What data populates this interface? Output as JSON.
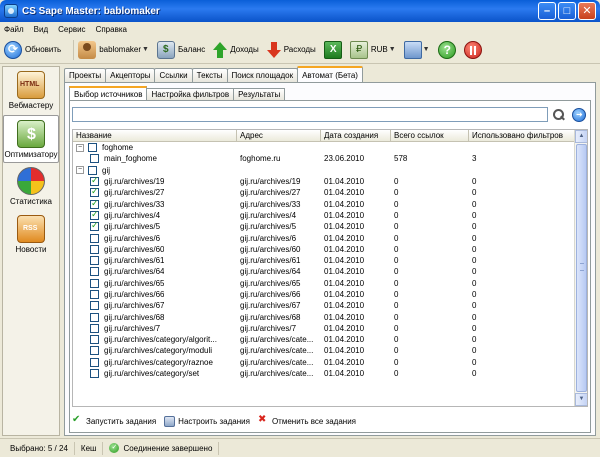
{
  "window": {
    "title": "CS Sape Master: bablomaker"
  },
  "menu": [
    "Файл",
    "Вид",
    "Сервис",
    "Справка"
  ],
  "toolbar": {
    "refresh": "Обновить",
    "user": "bablomaker",
    "balance": "Баланс",
    "income": "Доходы",
    "expenses": "Расходы",
    "currency": "RUB"
  },
  "sidebar": [
    {
      "label": "Вебмастеру",
      "icon": "webmaster-icon"
    },
    {
      "label": "Оптимизатору",
      "icon": "optimizer-icon"
    },
    {
      "label": "Статистика",
      "icon": "statistics-icon"
    },
    {
      "label": "Новости",
      "icon": "news-icon"
    }
  ],
  "tabs": [
    "Проекты",
    "Акцепторы",
    "Ссылки",
    "Тексты",
    "Поиск площадок",
    "Автомат (Бета)"
  ],
  "active_tab": 5,
  "subtabs": [
    "Выбор источников",
    "Настройка фильтров",
    "Результаты"
  ],
  "active_subtab": 0,
  "search": {
    "value": "",
    "placeholder": ""
  },
  "grid": {
    "columns": [
      "Название",
      "Адрес",
      "Дата создания",
      "Всего ссылок",
      "Использовано фильтров"
    ],
    "rows": [
      {
        "type": "group",
        "name": "foghome",
        "checked": false,
        "expanded": true
      },
      {
        "type": "item",
        "name": "main_foghome",
        "address": "foghome.ru",
        "date": "23.06.2010",
        "links": "578",
        "used": "3",
        "checked": false
      },
      {
        "type": "group",
        "name": "gij",
        "checked": false,
        "expanded": true
      },
      {
        "type": "item",
        "name": "gij.ru/archives/19",
        "address": "gij.ru/archives/19",
        "date": "01.04.2010",
        "links": "0",
        "used": "0",
        "checked": true
      },
      {
        "type": "item",
        "name": "gij.ru/archives/27",
        "address": "gij.ru/archives/27",
        "date": "01.04.2010",
        "links": "0",
        "used": "0",
        "checked": true
      },
      {
        "type": "item",
        "name": "gij.ru/archives/33",
        "address": "gij.ru/archives/33",
        "date": "01.04.2010",
        "links": "0",
        "used": "0",
        "checked": true
      },
      {
        "type": "item",
        "name": "gij.ru/archives/4",
        "address": "gij.ru/archives/4",
        "date": "01.04.2010",
        "links": "0",
        "used": "0",
        "checked": true
      },
      {
        "type": "item",
        "name": "gij.ru/archives/5",
        "address": "gij.ru/archives/5",
        "date": "01.04.2010",
        "links": "0",
        "used": "0",
        "checked": true
      },
      {
        "type": "item",
        "name": "gij.ru/archives/6",
        "address": "gij.ru/archives/6",
        "date": "01.04.2010",
        "links": "0",
        "used": "0",
        "checked": false
      },
      {
        "type": "item",
        "name": "gij.ru/archives/60",
        "address": "gij.ru/archives/60",
        "date": "01.04.2010",
        "links": "0",
        "used": "0",
        "checked": false
      },
      {
        "type": "item",
        "name": "gij.ru/archives/61",
        "address": "gij.ru/archives/61",
        "date": "01.04.2010",
        "links": "0",
        "used": "0",
        "checked": false
      },
      {
        "type": "item",
        "name": "gij.ru/archives/64",
        "address": "gij.ru/archives/64",
        "date": "01.04.2010",
        "links": "0",
        "used": "0",
        "checked": false
      },
      {
        "type": "item",
        "name": "gij.ru/archives/65",
        "address": "gij.ru/archives/65",
        "date": "01.04.2010",
        "links": "0",
        "used": "0",
        "checked": false
      },
      {
        "type": "item",
        "name": "gij.ru/archives/66",
        "address": "gij.ru/archives/66",
        "date": "01.04.2010",
        "links": "0",
        "used": "0",
        "checked": false
      },
      {
        "type": "item",
        "name": "gij.ru/archives/67",
        "address": "gij.ru/archives/67",
        "date": "01.04.2010",
        "links": "0",
        "used": "0",
        "checked": false
      },
      {
        "type": "item",
        "name": "gij.ru/archives/68",
        "address": "gij.ru/archives/68",
        "date": "01.04.2010",
        "links": "0",
        "used": "0",
        "checked": false
      },
      {
        "type": "item",
        "name": "gij.ru/archives/7",
        "address": "gij.ru/archives/7",
        "date": "01.04.2010",
        "links": "0",
        "used": "0",
        "checked": false
      },
      {
        "type": "item",
        "name": "gij.ru/archives/category/algorit...",
        "address": "gij.ru/archives/cate...",
        "date": "01.04.2010",
        "links": "0",
        "used": "0",
        "checked": false
      },
      {
        "type": "item",
        "name": "gij.ru/archives/category/moduli",
        "address": "gij.ru/archives/cate...",
        "date": "01.04.2010",
        "links": "0",
        "used": "0",
        "checked": false
      },
      {
        "type": "item",
        "name": "gij.ru/archives/category/raznoe",
        "address": "gij.ru/archives/cate...",
        "date": "01.04.2010",
        "links": "0",
        "used": "0",
        "checked": false
      },
      {
        "type": "item",
        "name": "gij.ru/archives/category/set",
        "address": "gij.ru/archives/cate...",
        "date": "01.04.2010",
        "links": "0",
        "used": "0",
        "checked": false
      }
    ]
  },
  "actions": {
    "run": "Запустить задания",
    "configure": "Настроить задания",
    "cancel": "Отменить все задания"
  },
  "status": {
    "selected": "Выбрано: 5 / 24",
    "cache": "Кеш",
    "connection": "Соединение завершено"
  }
}
